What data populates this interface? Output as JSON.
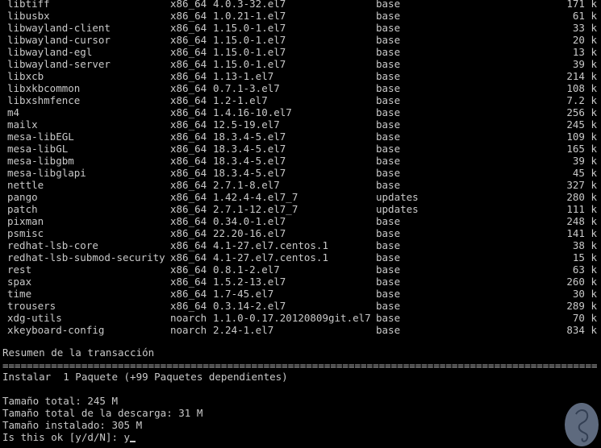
{
  "packages": [
    {
      "name": "libtiff",
      "arch": "x86_64",
      "version": "4.0.3-32.el7",
      "repo": "base",
      "size": "171 k"
    },
    {
      "name": "libusbx",
      "arch": "x86_64",
      "version": "1.0.21-1.el7",
      "repo": "base",
      "size": "61 k"
    },
    {
      "name": "libwayland-client",
      "arch": "x86_64",
      "version": "1.15.0-1.el7",
      "repo": "base",
      "size": "33 k"
    },
    {
      "name": "libwayland-cursor",
      "arch": "x86_64",
      "version": "1.15.0-1.el7",
      "repo": "base",
      "size": "20 k"
    },
    {
      "name": "libwayland-egl",
      "arch": "x86_64",
      "version": "1.15.0-1.el7",
      "repo": "base",
      "size": "13 k"
    },
    {
      "name": "libwayland-server",
      "arch": "x86_64",
      "version": "1.15.0-1.el7",
      "repo": "base",
      "size": "39 k"
    },
    {
      "name": "libxcb",
      "arch": "x86_64",
      "version": "1.13-1.el7",
      "repo": "base",
      "size": "214 k"
    },
    {
      "name": "libxkbcommon",
      "arch": "x86_64",
      "version": "0.7.1-3.el7",
      "repo": "base",
      "size": "108 k"
    },
    {
      "name": "libxshmfence",
      "arch": "x86_64",
      "version": "1.2-1.el7",
      "repo": "base",
      "size": "7.2 k"
    },
    {
      "name": "m4",
      "arch": "x86_64",
      "version": "1.4.16-10.el7",
      "repo": "base",
      "size": "256 k"
    },
    {
      "name": "mailx",
      "arch": "x86_64",
      "version": "12.5-19.el7",
      "repo": "base",
      "size": "245 k"
    },
    {
      "name": "mesa-libEGL",
      "arch": "x86_64",
      "version": "18.3.4-5.el7",
      "repo": "base",
      "size": "109 k"
    },
    {
      "name": "mesa-libGL",
      "arch": "x86_64",
      "version": "18.3.4-5.el7",
      "repo": "base",
      "size": "165 k"
    },
    {
      "name": "mesa-libgbm",
      "arch": "x86_64",
      "version": "18.3.4-5.el7",
      "repo": "base",
      "size": "39 k"
    },
    {
      "name": "mesa-libglapi",
      "arch": "x86_64",
      "version": "18.3.4-5.el7",
      "repo": "base",
      "size": "45 k"
    },
    {
      "name": "nettle",
      "arch": "x86_64",
      "version": "2.7.1-8.el7",
      "repo": "base",
      "size": "327 k"
    },
    {
      "name": "pango",
      "arch": "x86_64",
      "version": "1.42.4-4.el7_7",
      "repo": "updates",
      "size": "280 k"
    },
    {
      "name": "patch",
      "arch": "x86_64",
      "version": "2.7.1-12.el7_7",
      "repo": "updates",
      "size": "111 k"
    },
    {
      "name": "pixman",
      "arch": "x86_64",
      "version": "0.34.0-1.el7",
      "repo": "base",
      "size": "248 k"
    },
    {
      "name": "psmisc",
      "arch": "x86_64",
      "version": "22.20-16.el7",
      "repo": "base",
      "size": "141 k"
    },
    {
      "name": "redhat-lsb-core",
      "arch": "x86_64",
      "version": "4.1-27.el7.centos.1",
      "repo": "base",
      "size": "38 k"
    },
    {
      "name": "redhat-lsb-submod-security",
      "arch": "x86_64",
      "version": "4.1-27.el7.centos.1",
      "repo": "base",
      "size": "15 k"
    },
    {
      "name": "rest",
      "arch": "x86_64",
      "version": "0.8.1-2.el7",
      "repo": "base",
      "size": "63 k"
    },
    {
      "name": "spax",
      "arch": "x86_64",
      "version": "1.5.2-13.el7",
      "repo": "base",
      "size": "260 k"
    },
    {
      "name": "time",
      "arch": "x86_64",
      "version": "1.7-45.el7",
      "repo": "base",
      "size": "30 k"
    },
    {
      "name": "trousers",
      "arch": "x86_64",
      "version": "0.3.14-2.el7",
      "repo": "base",
      "size": "289 k"
    },
    {
      "name": "xdg-utils",
      "arch": "noarch",
      "version": "1.1.0-0.17.20120809git.el7",
      "repo": "base",
      "size": "70 k"
    },
    {
      "name": "xkeyboard-config",
      "arch": "noarch",
      "version": "2.24-1.el7",
      "repo": "base",
      "size": "834 k"
    }
  ],
  "summary": {
    "heading": "Resumen de la transacción",
    "separator": "==================================================================================================================",
    "install": "Instalar  1 Paquete (+99 Paquetes dependientes)",
    "total_size": "Tamaño total: 245 M",
    "download_size": "Tamaño total de la descarga: 31 M",
    "installed_size": "Tamaño instalado: 305 M",
    "prompt": "Is this ok [y/d/N]: ",
    "input": "y"
  },
  "colors": {
    "background": "#000000",
    "text": "#c9c9c9",
    "logo": "#6f7d95"
  },
  "logo": {
    "icon": "watermark-logo-icon"
  }
}
